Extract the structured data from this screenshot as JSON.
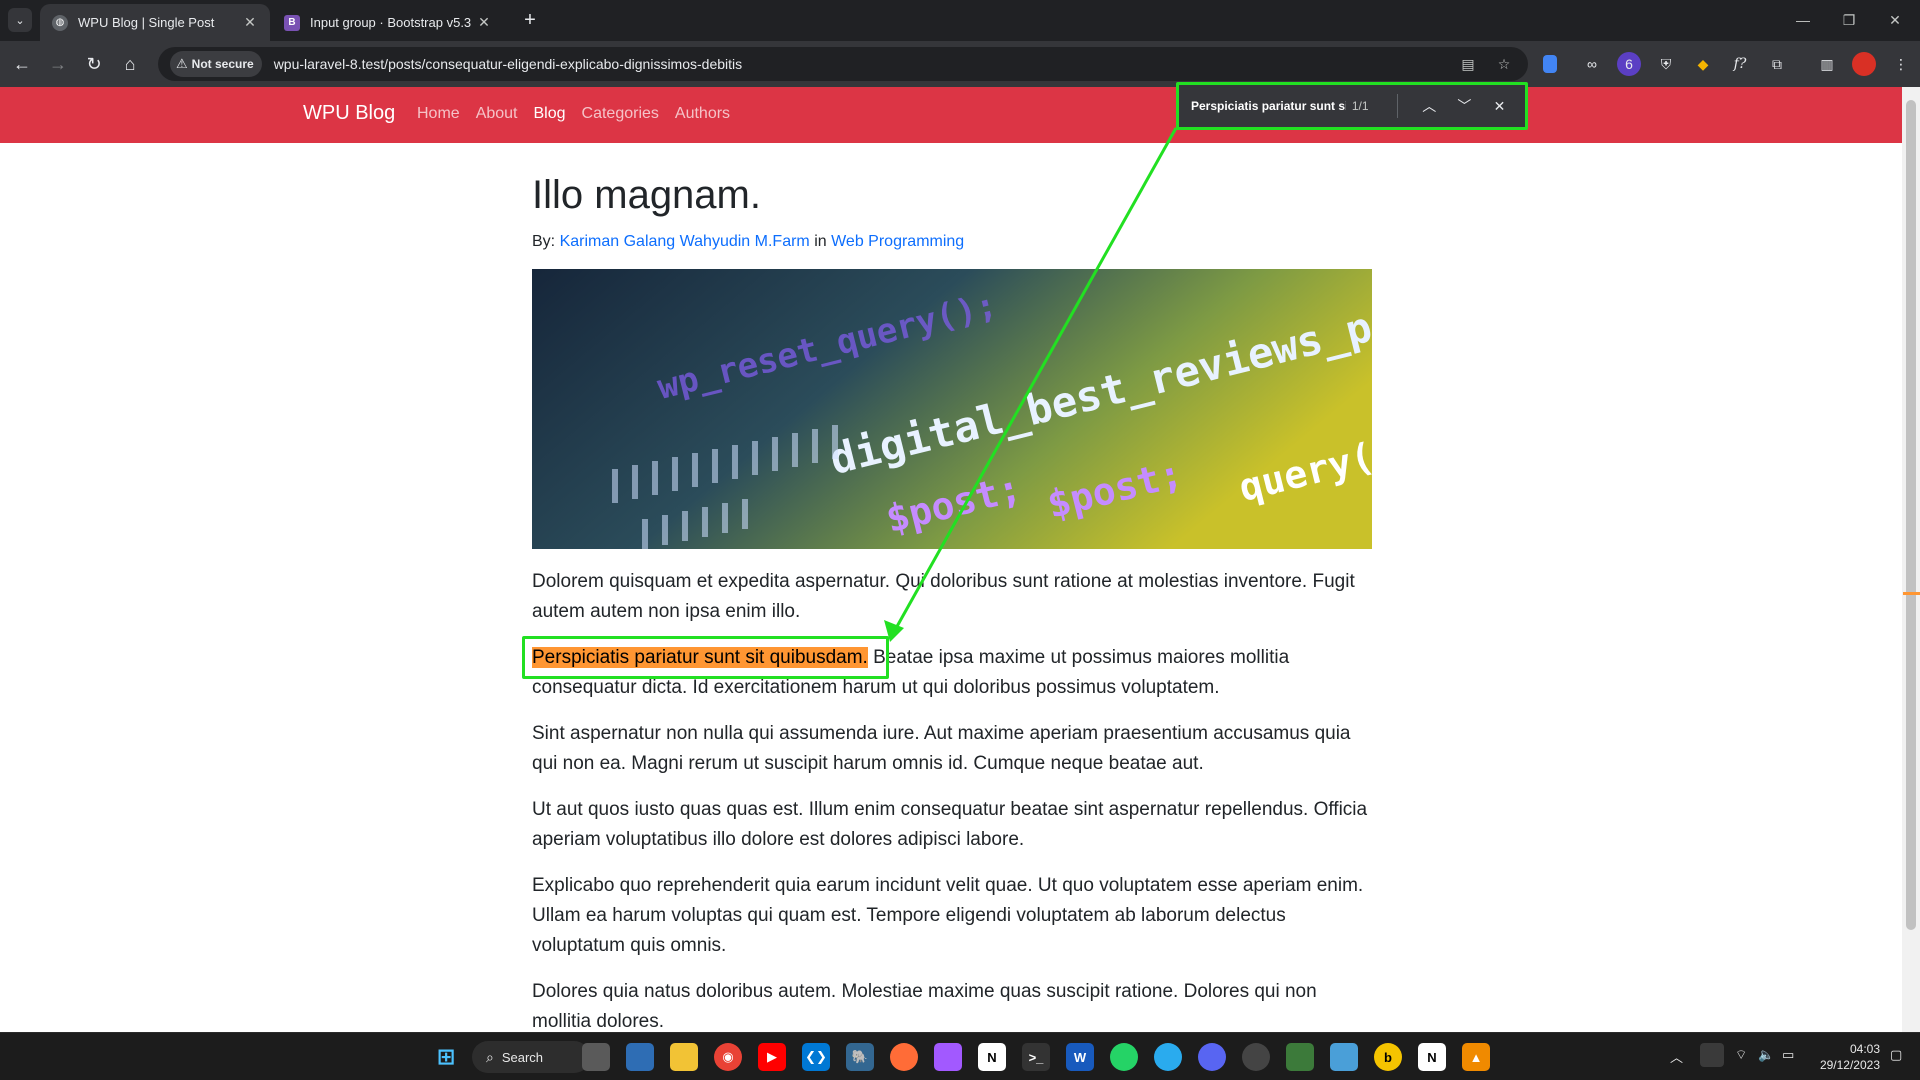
{
  "browser": {
    "tabs": [
      {
        "title": "WPU Blog | Single Post",
        "active": true
      },
      {
        "title": "Input group · Bootstrap v5.3",
        "active": false
      }
    ],
    "security_label": "Not secure",
    "url": "wpu-laravel-8.test/posts/consequatur-eligendi-explicabo-dignissimos-debitis",
    "find": {
      "query": "Perspiciatis pariatur sunt sit qu",
      "count": "1/1"
    }
  },
  "site": {
    "brand": "WPU Blog",
    "nav": [
      "Home",
      "About",
      "Blog",
      "Categories",
      "Authors"
    ],
    "active_nav": "Blog",
    "accent_color": "#dc3545",
    "link_color": "#0d6efd"
  },
  "post": {
    "title": "Illo magnam.",
    "by_label": "By:",
    "author": "Kariman Galang Wahyudin M.Farm",
    "in_label": "in",
    "category": "Web Programming",
    "hero_code_text": [
      "wp_reset_query();",
      "digital_best_reviews_posts",
      "$post;",
      "$post;",
      "query("
    ],
    "paragraphs": [
      "Dolorem quisquam et expedita aspernatur. Qui doloribus sunt ratione at molestias inventore. Fugit autem autem non ipsa enim illo.",
      "Beatae ipsa maxime ut possimus maiores mollitia consequatur dicta. Id exercitationem harum ut qui doloribus possimus voluptatem.",
      "Sint aspernatur non nulla qui assumenda iure. Aut maxime aperiam praesentium accusamus quia qui non ea. Magni rerum ut suscipit harum omnis id. Cumque neque beatae aut.",
      "Ut aut quos iusto quas quas est. Illum enim consequatur beatae sint aspernatur repellendus. Officia aperiam voluptatibus illo dolore est dolores adipisci labore.",
      "Explicabo quo reprehenderit quia earum incidunt velit quae. Ut quo voluptatem esse aperiam enim. Ullam ea harum voluptas qui quam est. Tempore eligendi voluptatem ab laborum delectus voluptatum quis omnis.",
      "Dolores quia natus doloribus autem. Molestiae maxime quas suscipit ratione. Dolores qui non mollitia dolores."
    ],
    "highlighted_sentence": "Perspiciatis pariatur sunt sit quibusdam.",
    "highlight_color": "#ff9632",
    "annotation_color": "#22e022"
  },
  "taskbar": {
    "search_label": "Search",
    "time": "04:03",
    "date": "29/12/2023"
  }
}
